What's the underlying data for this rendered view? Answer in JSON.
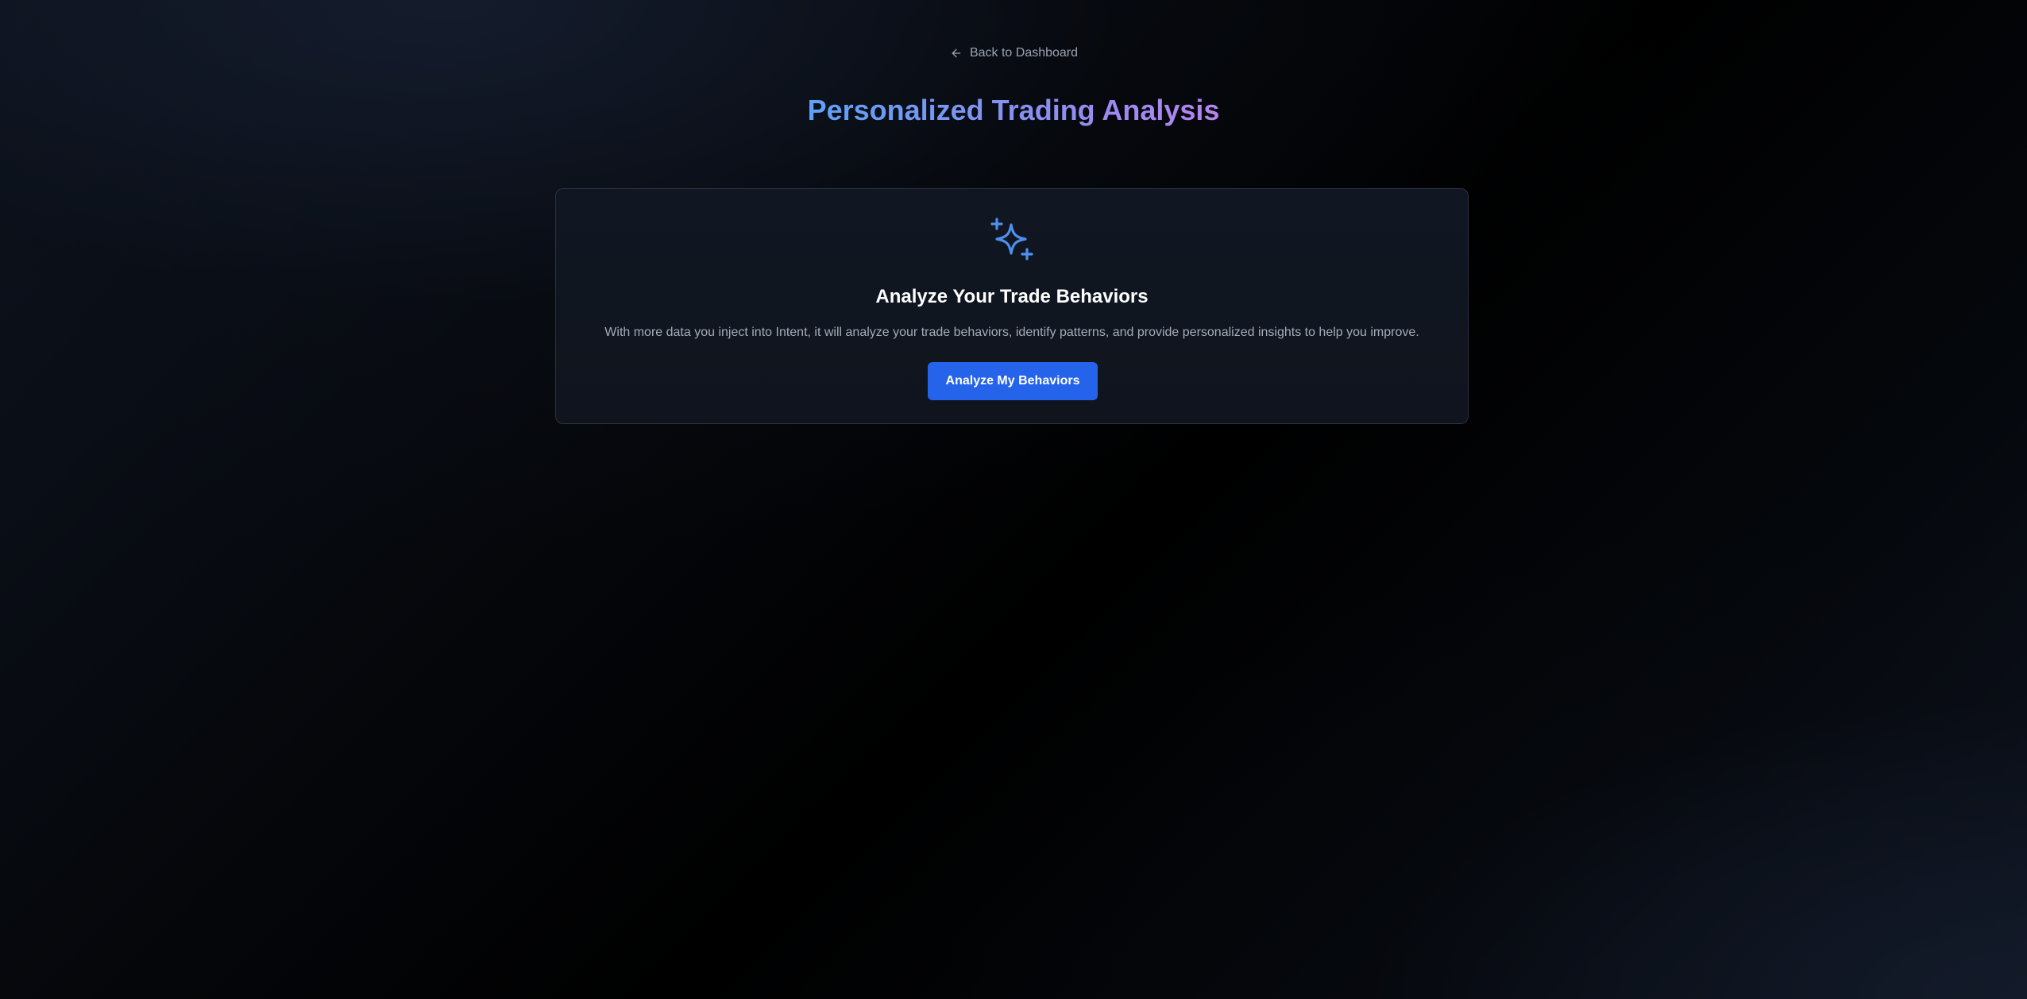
{
  "nav": {
    "back_label": "Back to Dashboard",
    "back_icon": "arrow-left-icon"
  },
  "header": {
    "title": "Personalized Trading Analysis"
  },
  "card": {
    "icon": "sparkles-icon",
    "title": "Analyze Your Trade Behaviors",
    "description": "With more data you inject into Intent, it will analyze your trade behaviors, identify patterns, and provide personalized insights to help you improve.",
    "button_label": "Analyze My Behaviors"
  },
  "colors": {
    "accent": "#2563eb",
    "icon": "#4f8ff0",
    "title_gradient_start": "#5ea1f7",
    "title_gradient_end": "#b684f0"
  }
}
